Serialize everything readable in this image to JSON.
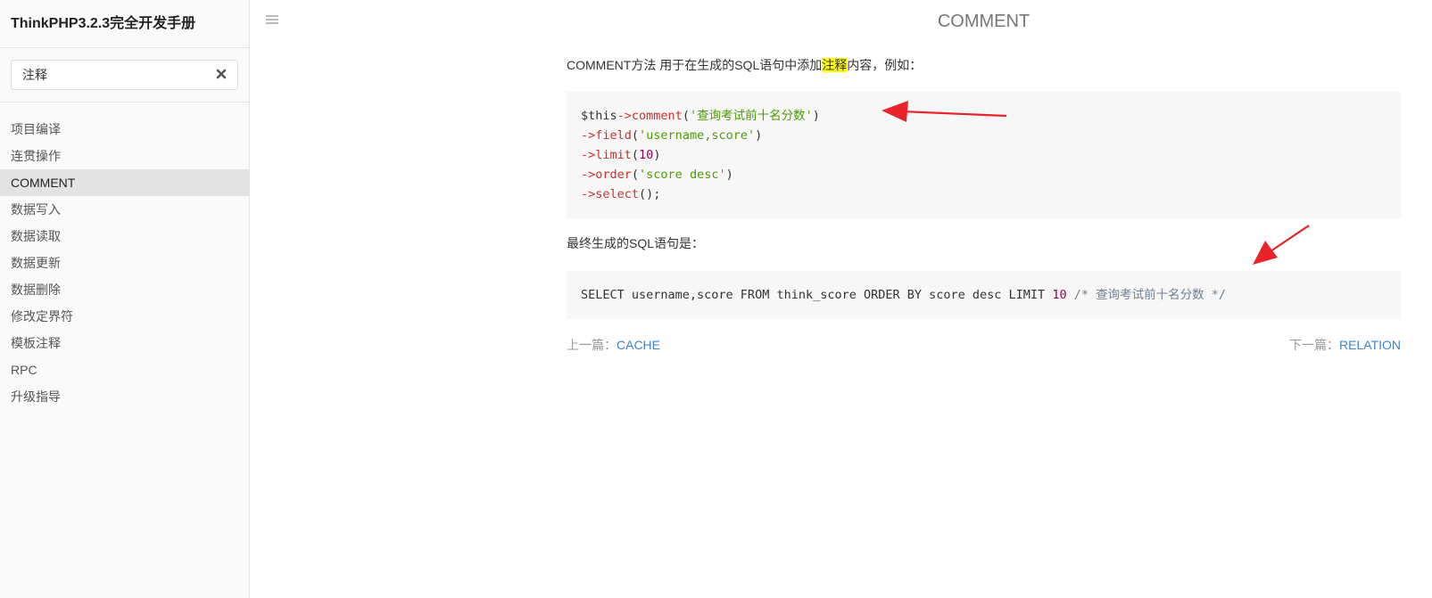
{
  "sidebar": {
    "book_title": "ThinkPHP3.2.3完全开发手册",
    "search": {
      "value": "注释",
      "placeholder": ""
    },
    "items": [
      {
        "label": "项目编译",
        "active": false
      },
      {
        "label": "连贯操作",
        "active": false
      },
      {
        "label": "COMMENT",
        "active": true
      },
      {
        "label": "数据写入",
        "active": false
      },
      {
        "label": "数据读取",
        "active": false
      },
      {
        "label": "数据更新",
        "active": false
      },
      {
        "label": "数据删除",
        "active": false
      },
      {
        "label": "修改定界符",
        "active": false
      },
      {
        "label": "模板注释",
        "active": false
      },
      {
        "label": "RPC",
        "active": false
      },
      {
        "label": "升级指导",
        "active": false
      }
    ]
  },
  "main": {
    "title": "COMMENT",
    "intro": {
      "before": "COMMENT方法 用于在生成的SQL语句中添加",
      "highlight": "注释",
      "after": "内容，例如："
    },
    "code1": {
      "line1": {
        "var": "$this",
        "op": "->",
        "fn": "comment",
        "open": "(",
        "str": "'查询考试前十名分数'",
        "close": ")"
      },
      "line2": {
        "op": "->",
        "fn": "field",
        "open": "(",
        "str": "'username,score'",
        "close": ")"
      },
      "line3": {
        "op": "->",
        "fn": "limit",
        "open": "(",
        "num": "10",
        "close": ")"
      },
      "line4": {
        "op": "->",
        "fn": "order",
        "open": "(",
        "str": "'score desc'",
        "close": ")"
      },
      "line5": {
        "op": "->",
        "fn": "select",
        "rest": "();"
      }
    },
    "result_label": "最终生成的SQL语句是：",
    "code2": {
      "sql": "SELECT username,score FROM think_score ORDER BY score desc LIMIT ",
      "num": "10",
      "comment": " /* 查询考试前十名分数 */"
    },
    "prev": {
      "label": "上一篇：",
      "target": "CACHE"
    },
    "next": {
      "label": "下一篇：",
      "target": "RELATION"
    }
  },
  "colors": {
    "highlight": "#ffff00",
    "link": "#4183c4",
    "arrow": "#e8242a"
  }
}
